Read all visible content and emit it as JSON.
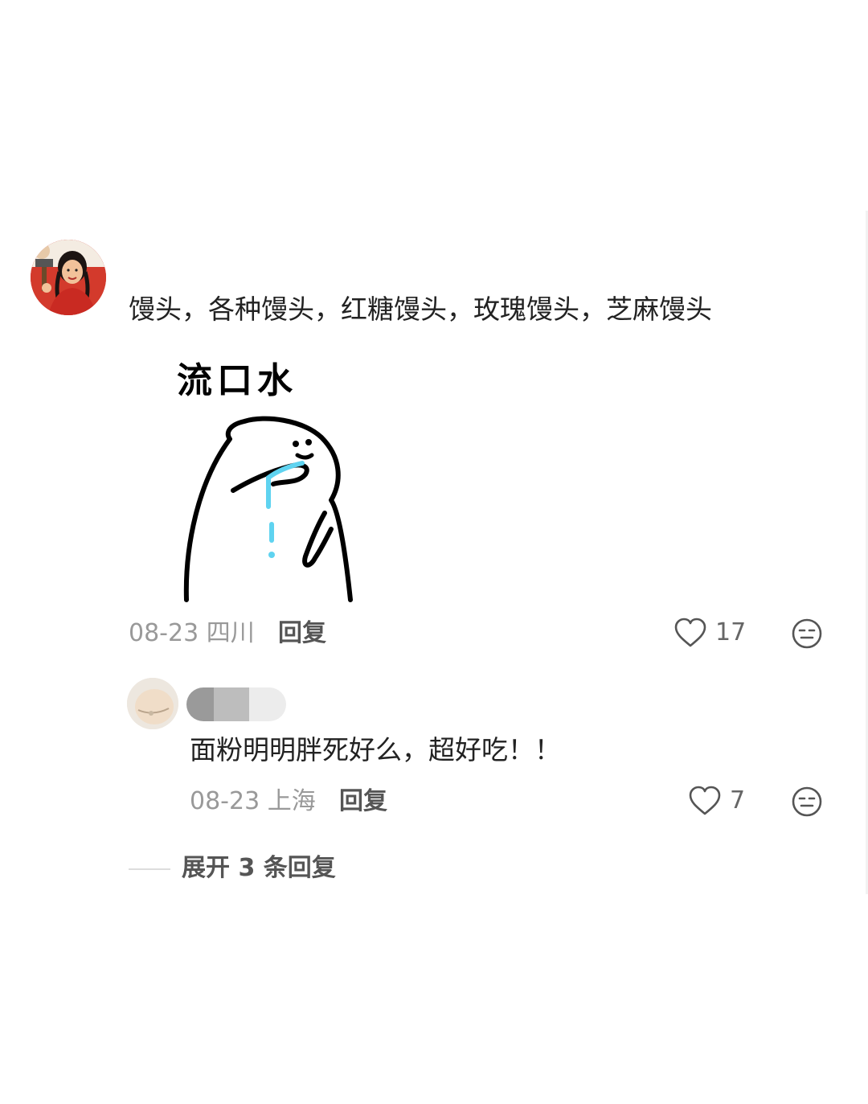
{
  "comment": {
    "text": "馒头，各种馒头，红糖馒头，玫瑰馒头，芝麻馒头",
    "sticker": {
      "caption": "流口水"
    },
    "date": "08-23",
    "location": "四川",
    "reply_label": "回复",
    "likes": "17",
    "icons": {
      "avatar": "avatar-image",
      "like": "heart-outline-icon",
      "dislike": "neutral-face-icon"
    }
  },
  "reply": {
    "text": "面粉明明胖死好么，超好吃！！",
    "date": "08-23",
    "location": "上海",
    "reply_label": "回复",
    "likes": "7",
    "username_redacted": true,
    "icons": {
      "avatar": "avatar-image",
      "like": "heart-outline-icon",
      "dislike": "neutral-face-icon"
    }
  },
  "expand_replies": {
    "label": "展开 3 条回复"
  },
  "colors": {
    "text_primary": "#222222",
    "text_meta": "#999999",
    "text_action": "#555555",
    "drool": "#5fd3f0"
  }
}
